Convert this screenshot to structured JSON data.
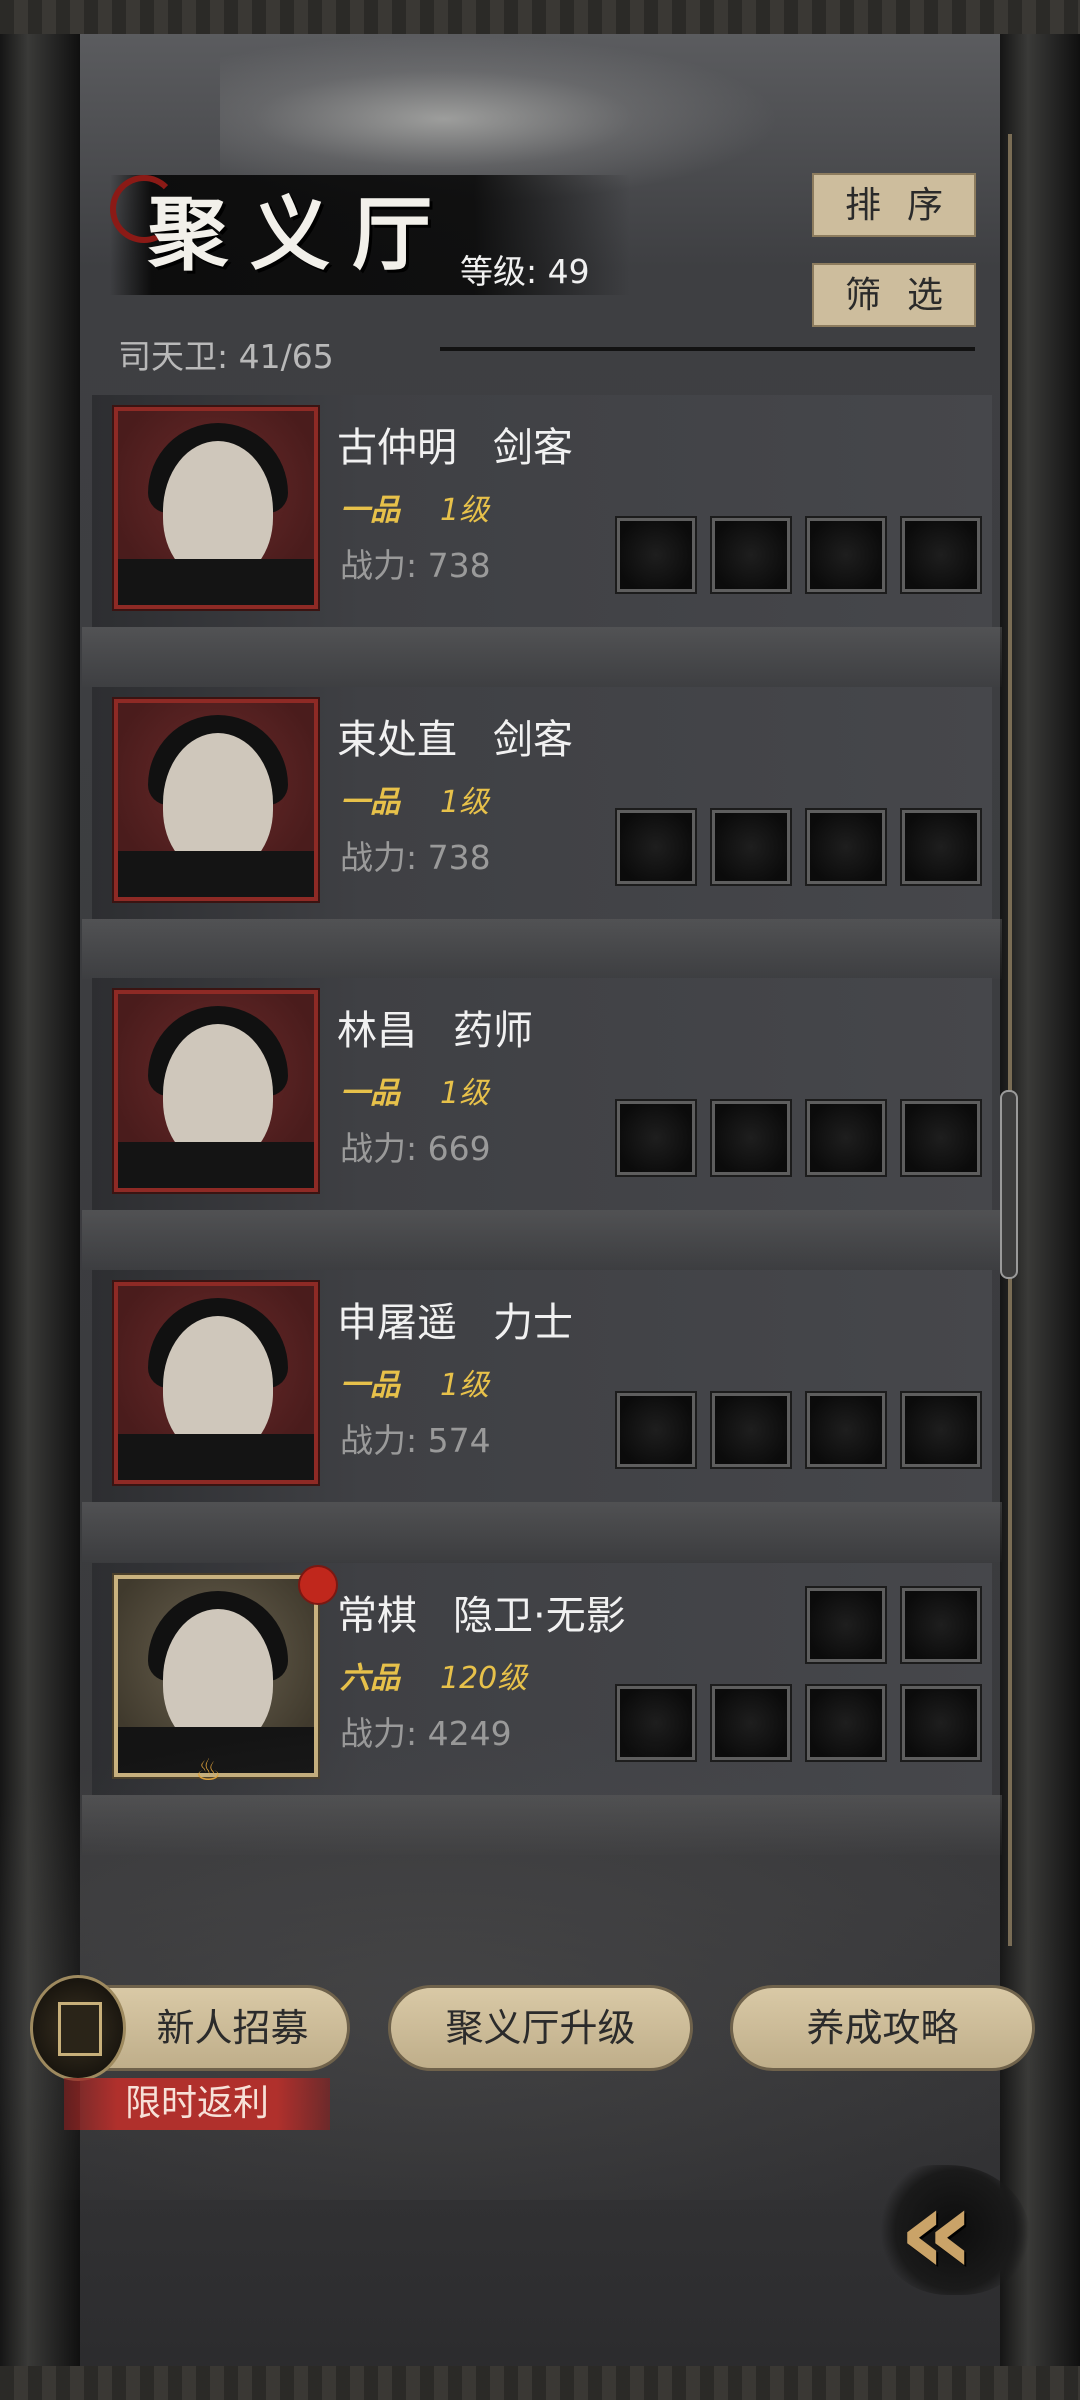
{
  "header": {
    "title": "聚义厅",
    "level": "等级: 49",
    "guard_count": "司天卫: 41/65",
    "sort_label": "排序",
    "filter_label": "筛选"
  },
  "heroes": [
    {
      "name": "古仲明",
      "class": "剑客",
      "rank": "一品",
      "level": "1级",
      "power": "战力: 738",
      "frame": "red"
    },
    {
      "name": "束处直",
      "class": "剑客",
      "rank": "一品",
      "level": "1级",
      "power": "战力: 738",
      "frame": "red"
    },
    {
      "name": "林昌",
      "class": "药师",
      "rank": "一品",
      "level": "1级",
      "power": "战力: 669",
      "frame": "red"
    },
    {
      "name": "申屠遥",
      "class": "力士",
      "rank": "一品",
      "level": "1级",
      "power": "战力: 574",
      "frame": "red"
    },
    {
      "name": "常棋",
      "class": "隐卫·无影",
      "rank": "六品",
      "level": "120级",
      "power": "战力: 4249",
      "frame": "gold"
    }
  ],
  "actions": {
    "recruit": "新人招募",
    "promo": "限时返利",
    "upgrade": "聚义厅升级",
    "guide": "养成攻略"
  },
  "colors": {
    "accent_gold": "#e7c14a",
    "button_beige": "#cdbd9d",
    "frame_red": "#8e2a25",
    "frame_gold": "#c9b27f",
    "notify_red": "#c0271c"
  },
  "icons": [
    "back-chevron-icon",
    "recruit-token-icon",
    "notification-dot-icon",
    "flame-icon"
  ]
}
